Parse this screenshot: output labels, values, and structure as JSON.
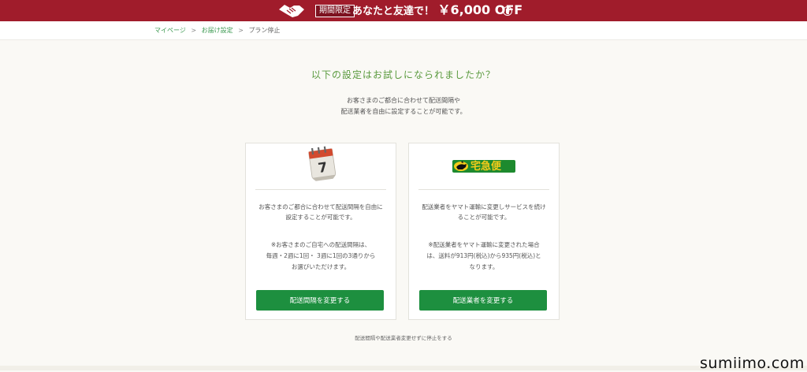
{
  "banner": {
    "badge": "期間限定",
    "text": "あなたと友達で！",
    "amount": "￥6,000 OFF",
    "icon": "handshake-icon",
    "play_icon": "play-circle-icon",
    "color": "#a01c2b"
  },
  "breadcrumb": {
    "items": [
      "マイページ",
      "お届け設定",
      "プラン停止"
    ],
    "separator": ">"
  },
  "heading": "以下の設定はお試しになられましたか？",
  "intro": {
    "line1": "お客さまのご都合に合わせて配送間隔や",
    "line2": "配送業者を自由に設定することが可能です。"
  },
  "cards": [
    {
      "icon": "calendar-icon",
      "calendar_number": "7",
      "desc_line1": "お客さまのご都合に合わせて配送間隔を自由に",
      "desc_line2": "設定することが可能です。",
      "note_line1": "※お客さまのご自宅への配送間隔は、",
      "note_line2": "毎週・2週に1回・ 3週に1回の3通りから",
      "note_line3": "お選びいただけます。",
      "button": "配送間隔を変更する"
    },
    {
      "icon": "yamato-logo-icon",
      "logo_text": "宅急便",
      "desc_line1": "配送業者をヤマト運輸に変更しサービスを続け",
      "desc_line2": "ることが可能です。",
      "note_line1": "※配送業者をヤマト運輸に変更された場合",
      "note_line2": "は、送料が913円(税込)から935円(税込)と",
      "note_line3": "なります。",
      "button": "配送業者を変更する"
    }
  ],
  "stop_link": "配送間隔や配送業者変更せずに停止をする",
  "watermark": "sumiimo.com",
  "colors": {
    "accent_green": "#1d8f3f",
    "heading_green": "#5a9a3e",
    "background": "#faf9f5"
  }
}
